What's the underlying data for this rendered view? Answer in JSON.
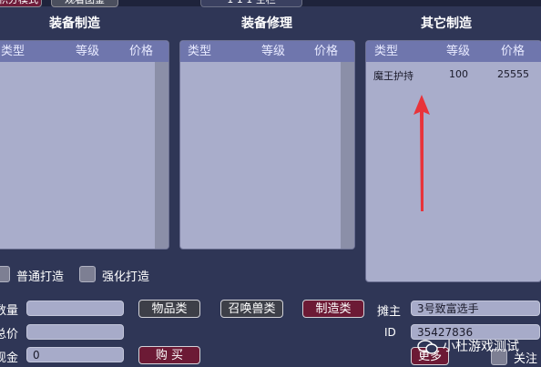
{
  "top_buttons": {
    "left": "积分模式",
    "middle": "观看图鉴",
    "center": "1 1 1 空栏"
  },
  "sections": {
    "equip_make": {
      "title": "装备制造",
      "cols": [
        "类型",
        "等级",
        "价格"
      ]
    },
    "equip_repair": {
      "title": "装备修理",
      "cols": [
        "类型",
        "等级",
        "价格"
      ]
    },
    "other_make": {
      "title": "其它制造",
      "cols": [
        "类型",
        "等级",
        "价格"
      ],
      "rows": [
        {
          "type": "魔王护持",
          "level": "100",
          "price": "25555"
        }
      ]
    }
  },
  "options": {
    "normal": "普通打造",
    "strong": "强化打造"
  },
  "form": {
    "qty_label": "数量",
    "total_label": "总价",
    "cash_label": "现金",
    "cash_value": "0"
  },
  "buttons": {
    "items": "物品类",
    "summon": "召唤兽类",
    "make": "制造类",
    "buy": "购 买",
    "more": "更多"
  },
  "owner": {
    "owner_label": "摊主",
    "owner_value": "3号致富选手",
    "id_label": "ID",
    "id_value": "35427836"
  },
  "follow_label": "关注",
  "watermark": "小杜游戏测试"
}
